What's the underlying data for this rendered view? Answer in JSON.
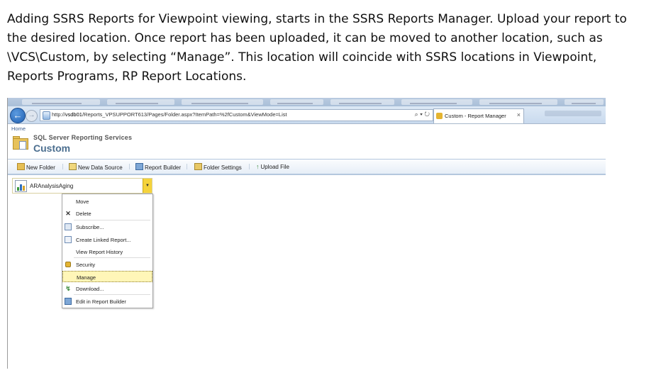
{
  "intro_text": "Adding SSRS Reports for Viewpoint viewing, starts in the SSRS Reports Manager. Upload your report to the desired location. Once report has been uploaded, it can be moved to another location, such as \\VCS\\Custom, by selecting “Manage”. This location will coincide with SSRS locations in Viewpoint, Reports Programs, RP Report Locations.",
  "browser": {
    "address_prefix": "http://",
    "address_host": "vsdb01",
    "address_path": "/Reports_VPSUPPORT613/Pages/Folder.aspx?ItemPath=%2fCustom&ViewMode=List",
    "address_tools": "⌕ ▾ ↻",
    "active_tab_title": "Custom - Report Manager",
    "close_glyph": "×",
    "back_glyph": "←",
    "forward_glyph": "→"
  },
  "page": {
    "breadcrumb": "Home",
    "product_title": "SQL Server Reporting Services",
    "folder_title": "Custom"
  },
  "toolbar": {
    "new_folder": "New Folder",
    "new_data_source": "New Data Source",
    "report_builder": "Report Builder",
    "folder_settings": "Folder Settings",
    "upload_file": "Upload File"
  },
  "report": {
    "name": "ARAnalysisAging",
    "dropdown_glyph": "▼"
  },
  "context_menu": {
    "items": [
      {
        "label": "Move",
        "icon": "none"
      },
      {
        "label": "Delete",
        "icon": "x-icon"
      },
      {
        "label": "Subscribe...",
        "icon": "subscribe-icon"
      },
      {
        "label": "Create Linked Report...",
        "icon": "linked-report-icon"
      },
      {
        "label": "View Report History",
        "icon": "none"
      },
      {
        "label": "Security",
        "icon": "lock-icon"
      },
      {
        "label": "Manage",
        "icon": "none",
        "highlighted": true
      },
      {
        "label": "Download...",
        "icon": "download-icon"
      },
      {
        "label": "Edit in Report Builder",
        "icon": "report-builder-icon"
      }
    ],
    "delete_glyph": "✕",
    "download_glyph": "↯"
  },
  "colors": {
    "highlight": "#fff6b8",
    "dropdown_button": "#f5d33b",
    "title_blue": "#4b6e8f"
  }
}
